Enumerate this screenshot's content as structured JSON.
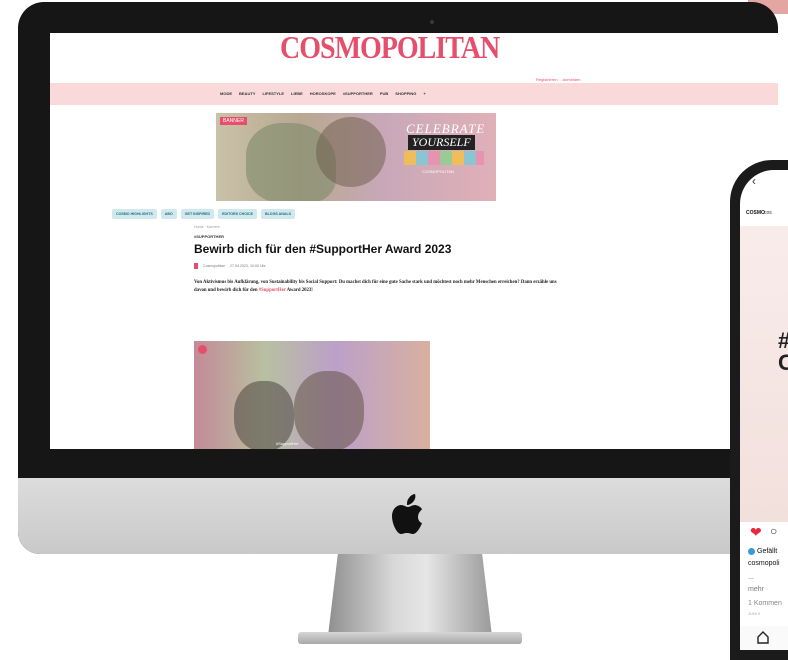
{
  "website": {
    "logo": "COSMOPOLITAN",
    "auth": [
      "Registrieren",
      "Anmelden"
    ],
    "nav_items": [
      "MODE",
      "BEAUTY",
      "LIFESTYLE",
      "LIEBE",
      "HOROSKOPE",
      "#SUPPORTHER",
      "PUB",
      "SHOPPING"
    ],
    "banner": {
      "tag": "BANNER",
      "line1": "CELEBRATE",
      "line2": "YOURSELF",
      "footer": "COSMOPOLITAN"
    },
    "pills": [
      "COSMO HIGHLIGHTS",
      "ABO",
      "GET INSPIRED",
      "EDITORS CHOICE",
      "BLOGS ANALS"
    ],
    "article": {
      "breadcrumb": "Home · Karriere",
      "kicker": "#SUPPORTHER",
      "title": "Bewirb dich für den #SupportHer Award 2023",
      "author": "Cosmopolitan",
      "date": "27.04.2023, 10:00 Uhr",
      "body": "Von Aktivismus bis Aufklärung, von Sustainability bis Social Support: Du machst dich für eine gute Sache stark und möchtest noch mehr Menschen erreichen? Dann erzähle uns davon und bewirb dich für den",
      "body_highlight": "#SupportHer",
      "body_end": "Award 2023!",
      "photo_caption": "#SupportHer"
    }
  },
  "phone": {
    "back": "‹",
    "account_logo": "COSMO",
    "account_name": "cos",
    "hashtag": "#\nC",
    "likes_text": "Gefällt",
    "username": "cosmopoli",
    "dots": "...",
    "more": "mehr",
    "comments": "1 Kommen",
    "date": "JUNI 9"
  }
}
